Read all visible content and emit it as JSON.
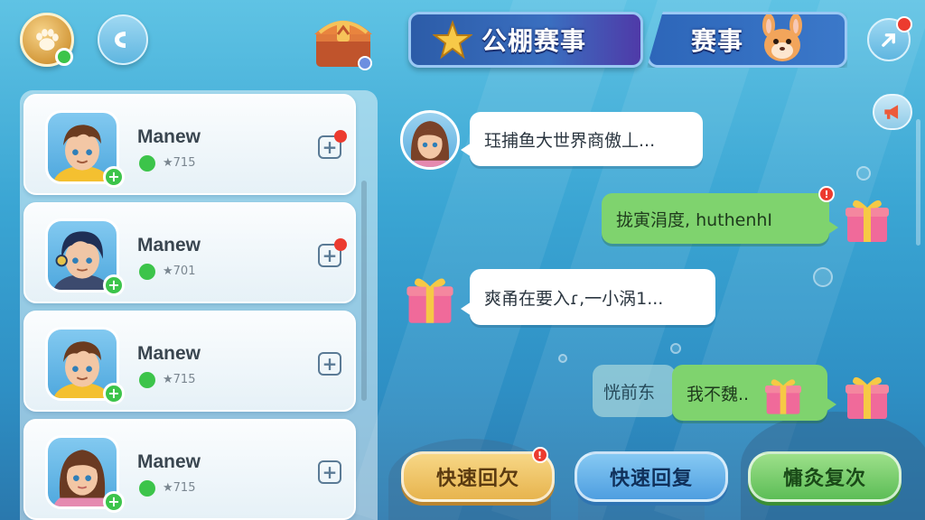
{
  "header": {
    "banner_1_text": "公棚赛事",
    "banner_2_text": "赛事"
  },
  "friends": [
    {
      "name": "Manew",
      "score": "★715",
      "has_notification": true
    },
    {
      "name": "Manew",
      "score": "★701",
      "has_notification": true
    },
    {
      "name": "Manew",
      "score": "★715",
      "has_notification": false
    },
    {
      "name": "Manew",
      "score": "★715",
      "has_notification": false
    }
  ],
  "chat": {
    "messages": [
      {
        "side": "left",
        "sender": "avatar",
        "text": "珏捕鱼大世界商傲丄..."
      },
      {
        "side": "right",
        "sender": "gift",
        "text": "拢寅涓度, huthenhⅠ"
      },
      {
        "side": "left",
        "sender": "gift",
        "text": "爽甬在要入ɾ,一小涡1..."
      },
      {
        "side": "right",
        "sender": "gift",
        "text": "我不魏..",
        "preview_text": "恍前东"
      }
    ]
  },
  "quick_replies": [
    {
      "label": "快速回欠",
      "has_badge": true
    },
    {
      "label": "快速回复",
      "has_badge": false
    },
    {
      "label": "慵灸复次",
      "has_badge": false
    }
  ],
  "colors": {
    "online": "#3cc44a",
    "badge": "#ec3b2f",
    "bubble_self": "#7fd36e",
    "bubble_other": "#ffffff"
  }
}
